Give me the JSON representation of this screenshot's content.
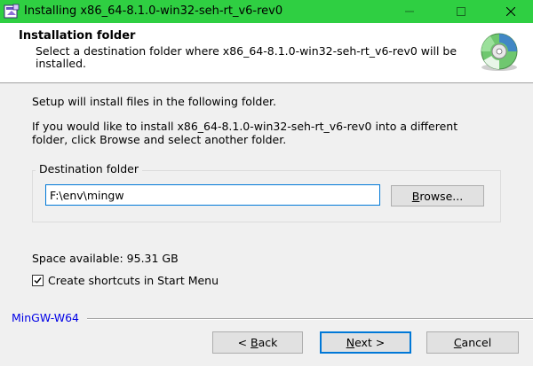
{
  "window": {
    "title": "Installing x86_64-8.1.0-win32-seh-rt_v6-rev0"
  },
  "header": {
    "title": "Installation folder",
    "subtitle": "Select a destination folder where x86_64-8.1.0-win32-seh-rt_v6-rev0 will be installed."
  },
  "body": {
    "intro": "Setup will install files in the following folder.",
    "instructions_line1": "If you would like to install x86_64-8.1.0-win32-seh-rt_v6-rev0 into a different",
    "instructions_line2": "folder, click Browse and select another folder."
  },
  "destination": {
    "group_label": "Destination folder",
    "path_value": "F:\\env\\mingw",
    "browse_pre": "B",
    "browse_rest": "rowse..."
  },
  "space": {
    "label": "Space available: 95.31 GB"
  },
  "shortcuts": {
    "checked": true,
    "label": "Create shortcuts in Start Menu"
  },
  "footer": {
    "brand": "MinGW-W64",
    "back_pre": "< ",
    "back_u": "B",
    "back_rest": "ack",
    "next_u": "N",
    "next_rest": "ext >",
    "cancel_u": "C",
    "cancel_rest": "ancel"
  },
  "colors": {
    "titlebar": "#2fcf42",
    "focus_border": "#0078d7",
    "brand_text": "#0000e6"
  },
  "icons": [
    "installer-app-icon",
    "minimize-icon",
    "maximize-icon",
    "close-icon",
    "cd-disc-icon",
    "checkmark-icon"
  ]
}
